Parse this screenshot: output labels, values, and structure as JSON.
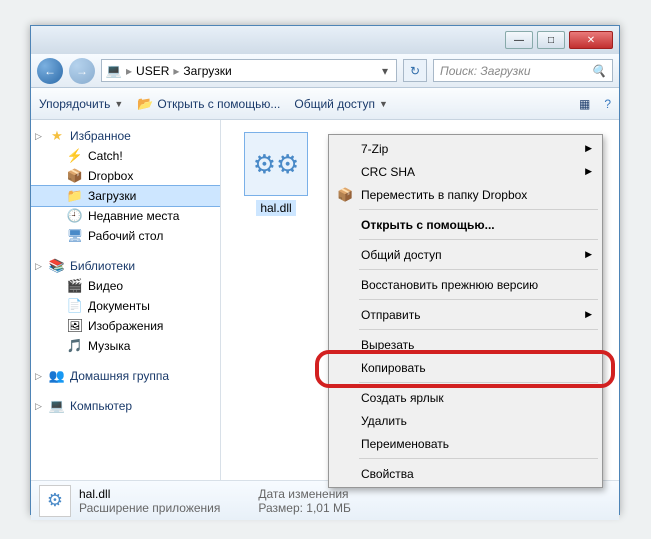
{
  "titlebar": {
    "min": "—",
    "max": "□",
    "close": "✕"
  },
  "nav": {
    "back": "←",
    "fwd": "→",
    "refresh": "↻"
  },
  "breadcrumb": {
    "icon": "💻",
    "parts": [
      "USER",
      "Загрузки"
    ],
    "sep": "▸",
    "dd": "▾"
  },
  "search": {
    "placeholder": "Поиск: Загрузки",
    "icon": "🔍"
  },
  "toolbar": {
    "organize": "Упорядочить",
    "organize_dd": "▼",
    "open": "Открыть с помощью...",
    "share": "Общий доступ",
    "share_dd": "▼",
    "view": "▦",
    "help": "?"
  },
  "tree": {
    "favorites": {
      "label": "Избранное",
      "icon": "★",
      "items": [
        {
          "label": "Catch!",
          "icon": "⚡"
        },
        {
          "label": "Dropbox",
          "icon": "📦"
        },
        {
          "label": "Загрузки",
          "icon": "📁",
          "sel": true
        },
        {
          "label": "Недавние места",
          "icon": "🕘"
        },
        {
          "label": "Рабочий стол",
          "icon": "🖥"
        }
      ]
    },
    "libraries": {
      "label": "Библиотеки",
      "icon": "📚",
      "items": [
        {
          "label": "Видео",
          "icon": "🎬"
        },
        {
          "label": "Документы",
          "icon": "📄"
        },
        {
          "label": "Изображения",
          "icon": "🖼"
        },
        {
          "label": "Музыка",
          "icon": "🎵"
        }
      ]
    },
    "homegroup": {
      "label": "Домашняя группа",
      "icon": "👥"
    },
    "computer": {
      "label": "Компьютер",
      "icon": "💻"
    }
  },
  "file": {
    "name": "hal.dll"
  },
  "status": {
    "name": "hal.dll",
    "type": "Расширение приложения",
    "date_label": "Дата изменения",
    "size_label": "Размер:",
    "size": "1,01 МБ"
  },
  "ctx": [
    {
      "t": "7-Zip",
      "arr": true
    },
    {
      "t": "CRC SHA",
      "arr": true
    },
    {
      "t": "Переместить в папку Dropbox",
      "icon": "📦"
    },
    {
      "sep": true
    },
    {
      "t": "Открыть с помощью...",
      "bold": true
    },
    {
      "sep": true
    },
    {
      "t": "Общий доступ",
      "arr": true
    },
    {
      "sep": true
    },
    {
      "t": "Восстановить прежнюю версию"
    },
    {
      "sep": true
    },
    {
      "t": "Отправить",
      "arr": true
    },
    {
      "sep": true
    },
    {
      "t": "Вырезать"
    },
    {
      "t": "Копировать"
    },
    {
      "sep": true
    },
    {
      "t": "Создать ярлык"
    },
    {
      "t": "Удалить"
    },
    {
      "t": "Переименовать"
    },
    {
      "sep": true
    },
    {
      "t": "Свойства"
    }
  ]
}
